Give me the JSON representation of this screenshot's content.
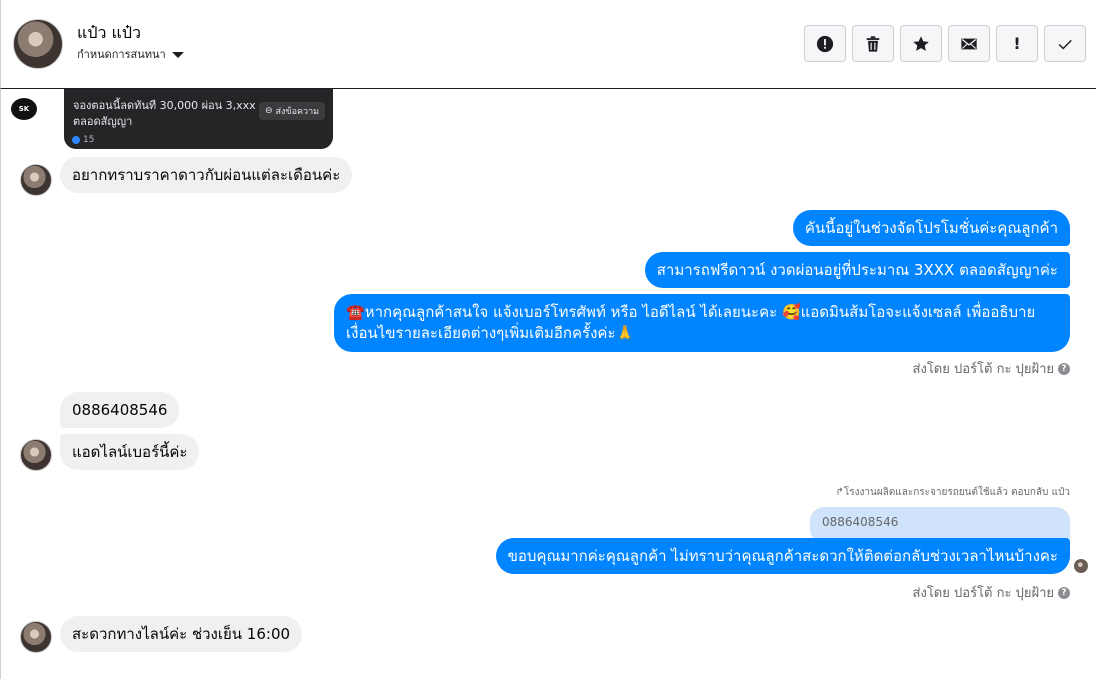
{
  "header": {
    "name": "แป๋ว แป๋ว",
    "assign_label": "กำหนดการสนทนา"
  },
  "toolbar": {
    "buttons": [
      {
        "icon": "alert-circle-icon"
      },
      {
        "icon": "trash-icon"
      },
      {
        "icon": "star-icon"
      },
      {
        "icon": "envelope-icon"
      },
      {
        "icon": "exclamation-icon",
        "label": "!"
      },
      {
        "icon": "check-icon"
      }
    ]
  },
  "card": {
    "text_line1": "จองตอนนี้ลดทันที 30,000 ผ่อน 3,xxx",
    "text_line2": "ตลอดสัญญา",
    "button_label": "ส่งข้อความ",
    "reaction_count": "15",
    "logo_text": "SK"
  },
  "messages": {
    "m1": "อยากทราบราคาดาวกับผ่อนแต่ละเดือนค่ะ",
    "m2": "คันนี้อยู่ในช่วงจัดโปรโมชั่นค่ะคุณลูกค้า",
    "m3": "สามารถฟรีดาวน์ งวดผ่อนอยู่ที่ประมาณ  3XXX ตลอดสัญญาค่ะ",
    "m4_line1": "☎️หากคุณลูกค้าสนใจ แจ้งเบอร์โทรศัพท์ หรือ ไอดีไลน์  ได้เลยนะคะ 🥰แอดมินส้มโอจะแจ้งเซลล์   เพื่ออธิบาย",
    "m4_line2": "เงื่อนไขรายละเอียดต่างๆเพิ่มเติมอีกครั้งค่ะ🙏",
    "sent_by_1": "ส่งโดย ปอร์โต้ กะ ปุยฝ้าย",
    "m5": "0886408546",
    "m6": "แอดไลน์เบอร์นี้ค่ะ",
    "reply_note": "↱โรงงานผลิตและกระจายรถยนต์ใช้แล้ว ตอบกลับ แป๋ว",
    "quoted": "0886408546",
    "m7": "ขอบคุณมากค่ะคุณลูกค้า ไม่ทราบว่าคุณลูกค้าสะดวกให้ติดต่อกลับช่วงเวลาไหนบ้างคะ",
    "sent_by_2": "ส่งโดย ปอร์โต้ กะ ปุยฝ้าย",
    "m8": "สะดวกทางไลน์ค่ะ ช่วงเย็น 16:00"
  },
  "colors": {
    "outgoing_bubble": "#0084ff",
    "incoming_bubble": "#f0f0f0",
    "quoted_bubble": "#cfe3fb"
  }
}
